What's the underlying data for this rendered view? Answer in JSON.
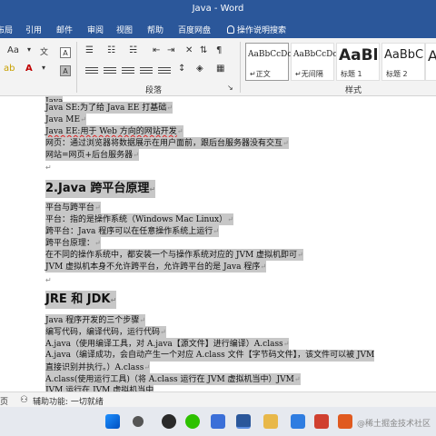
{
  "window": {
    "title": "Java  -  Word"
  },
  "tabs": [
    "布局",
    "引用",
    "邮件",
    "审阅",
    "视图",
    "帮助",
    "百度网盘",
    "操作说明搜索"
  ],
  "ribbon": {
    "font_size_label": "Aa",
    "paragraph_group": "段落",
    "styles_group": "样式",
    "styles": [
      {
        "sample": "AaBbCcDc",
        "name": "正文"
      },
      {
        "sample": "AaBbCcDc",
        "name": "无间隔"
      },
      {
        "sample": "AaBl",
        "name": "标题 1"
      },
      {
        "sample": "AaBbC",
        "name": "标题 2"
      },
      {
        "sample": "A",
        "name": ""
      }
    ]
  },
  "document": {
    "lines": [
      "Java SE:为了给 Java EE 打基础",
      "Java ME",
      "Java EE:用于 Web 方向的网站开发",
      "网页：通过浏览器将数据展示在用户面前，跟后台服务器没有交互",
      "网站=网页+后台服务器",
      "2.Java 跨平台原理",
      "平台与跨平台",
      "平台：指的是操作系统（Windows Mac Linux）",
      "跨平台：Java 程序可以在任意操作系统上运行",
      "跨平台原理：",
      "在不同的操作系统中，都安装一个与操作系统对应的 JVM 虚拟机即可",
      "JVM 虚拟机本身不允许跨平台，允许跨平台的是 Java 程序",
      "JRE 和 JDK",
      "Java 程序开发的三个步骤",
      "编写代码，编译代码，运行代码",
      "A.java（使用编译工具，对 A.java【源文件】进行编译）A.class",
      "A.java（编译成功，会自动产生一个对应 A.class 文件【字节码文件】，该文件可以被 JVM",
      "直接识别并执行。）A.class",
      "A.class(使用运行工具)（将 A.class 运行在 JVM 虚拟机当中）JVM"
    ]
  },
  "status": {
    "left": "页",
    "accessibility": "辅助功能: 一切就绪"
  },
  "taskbar": {
    "watermark": "@稀土掘金技术社区"
  }
}
